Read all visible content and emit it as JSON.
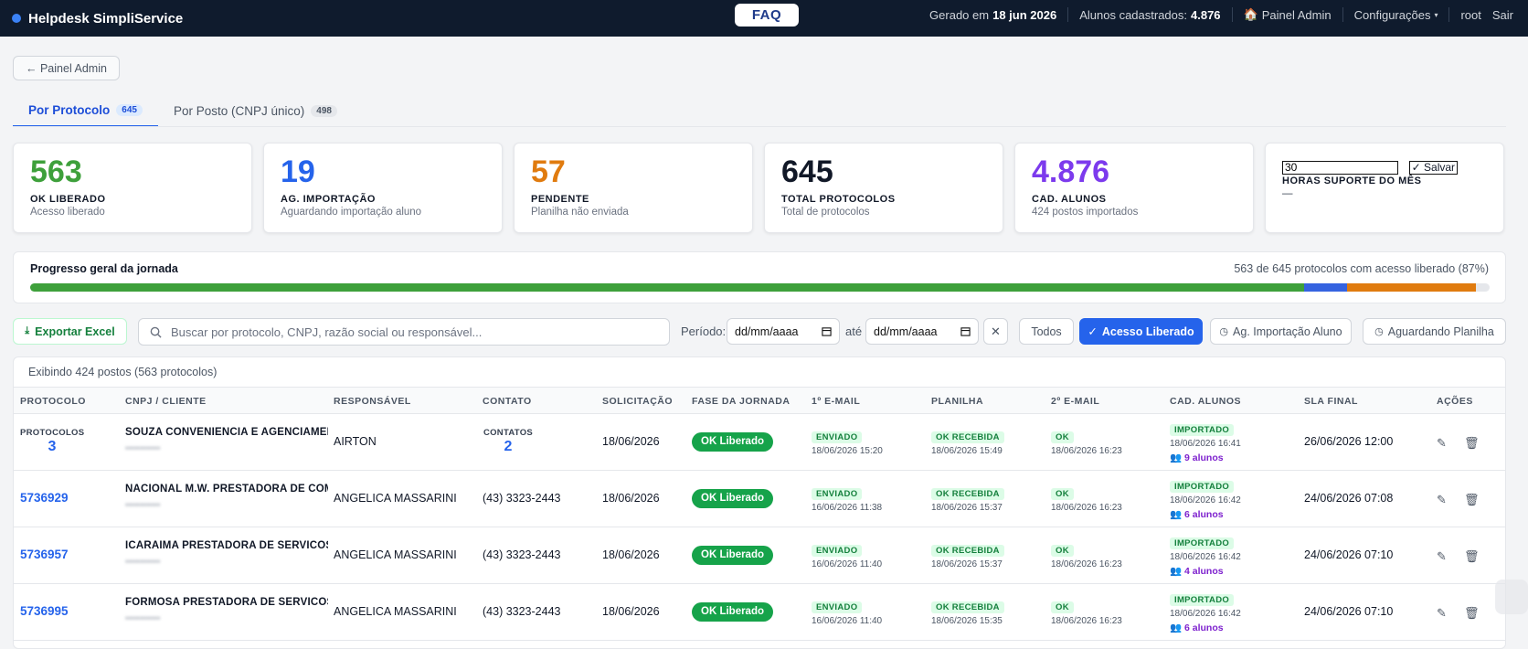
{
  "topbar": {
    "brand": "Helpdesk SimpliService",
    "faq": "FAQ",
    "generated_label": "Gerado em",
    "generated_date": "18 jun 2026",
    "students_label": "Alunos cadastrados:",
    "students_count": "4.876",
    "admin_link": "Painel Admin",
    "settings": "Configurações",
    "user": "root",
    "logout": "Sair"
  },
  "back_button": "← Painel Admin",
  "tabs": [
    {
      "label": "Por Protocolo",
      "count": "645"
    },
    {
      "label": "Por Posto (CNPJ único)",
      "count": "498"
    }
  ],
  "kpis": [
    {
      "value": "563",
      "title": "OK LIBERADO",
      "subtitle": "Acesso liberado",
      "color": "#3ea03b"
    },
    {
      "value": "19",
      "title": "AG. IMPORTAÇÃO",
      "subtitle": "Aguardando importação aluno",
      "color": "#2563eb"
    },
    {
      "value": "57",
      "title": "PENDENTE",
      "subtitle": "Planilha não enviada",
      "color": "#e07b0f"
    },
    {
      "value": "645",
      "title": "TOTAL PROTOCOLOS",
      "subtitle": "Total de protocolos",
      "color": "#111827"
    },
    {
      "value": "4.876",
      "title": "CAD. ALUNOS",
      "subtitle": "424 postos importados",
      "color": "#7c3aed"
    }
  ],
  "hours_card": {
    "input_value": "30",
    "save_label": "✓ Salvar",
    "title": "HORAS SUPORTE DO MÊS",
    "value": "—"
  },
  "progress": {
    "title": "Progresso geral da jornada",
    "summary": "563 de 645 protocolos com acesso liberado (87%)",
    "liberado": 563,
    "ag_importacao": 19,
    "pendente": 57,
    "total": 645
  },
  "filters": {
    "export_label": "Exportar Excel",
    "search_placeholder": "Buscar por protocolo, CNPJ, razão social ou responsável...",
    "period_label": "Período:",
    "date_from": "dd/mm/aaaa",
    "until_label": "até",
    "date_to": "dd/mm/aaaa",
    "status_filters": [
      "Todos",
      "Acesso Liberado",
      "Ag. Importação Aluno",
      "Aguardando Planilha"
    ],
    "active_filter": "Acesso Liberado"
  },
  "table": {
    "showing": "Exibindo 424 postos (563 protocolos)",
    "columns": [
      "PROTOCOLO",
      "CNPJ / CLIENTE",
      "RESPONSÁVEL",
      "CONTATO",
      "SOLICITAÇÃO",
      "FASE DA JORNADA",
      "1º E-MAIL",
      "PLANILHA",
      "2º E-MAIL",
      "CAD. ALUNOS",
      "SLA FINAL",
      "AÇÕES"
    ],
    "rows": [
      {
        "protocol_label": "PROTOCOLOS",
        "protocol": "3",
        "client": "SOUZA CONVENIENCIA E AGENCIAMEN",
        "responsavel": "AIRTON",
        "contact_label": "CONTATOS",
        "contact": "2",
        "solicitacao": "18/06/2026",
        "fase": "OK Liberado",
        "email1_status": "ENVIADO",
        "email1_date": "18/06/2026 15:20",
        "planilha_status": "OK RECEBIDA",
        "planilha_date": "18/06/2026 15:49",
        "email2_status": "OK",
        "email2_date": "18/06/2026 16:23",
        "cad_status": "IMPORTADO",
        "cad_date": "18/06/2026 16:41",
        "alunos": "9 alunos",
        "sla": "26/06/2026 12:00"
      },
      {
        "protocol": "5736929",
        "client": "NACIONAL M.W. PRESTADORA DE COMI",
        "responsavel": "ANGELICA MASSARINI",
        "contact": "(43) 3323-2443",
        "solicitacao": "18/06/2026",
        "fase": "OK Liberado",
        "email1_status": "ENVIADO",
        "email1_date": "16/06/2026 11:38",
        "planilha_status": "OK RECEBIDA",
        "planilha_date": "18/06/2026 15:37",
        "email2_status": "OK",
        "email2_date": "18/06/2026 16:23",
        "cad_status": "IMPORTADO",
        "cad_date": "18/06/2026 16:42",
        "alunos": "6 alunos",
        "sla": "24/06/2026 07:08"
      },
      {
        "protocol": "5736957",
        "client": "ICARAIMA PRESTADORA DE SERVICOS L",
        "responsavel": "ANGELICA MASSARINI",
        "contact": "(43) 3323-2443",
        "solicitacao": "18/06/2026",
        "fase": "OK Liberado",
        "email1_status": "ENVIADO",
        "email1_date": "16/06/2026 11:40",
        "planilha_status": "OK RECEBIDA",
        "planilha_date": "18/06/2026 15:37",
        "email2_status": "OK",
        "email2_date": "18/06/2026 16:23",
        "cad_status": "IMPORTADO",
        "cad_date": "18/06/2026 16:42",
        "alunos": "4 alunos",
        "sla": "24/06/2026 07:10"
      },
      {
        "protocol": "5736995",
        "client": "FORMOSA PRESTADORA DE SERVICOS L",
        "responsavel": "ANGELICA MASSARINI",
        "contact": "(43) 3323-2443",
        "solicitacao": "18/06/2026",
        "fase": "OK Liberado",
        "email1_status": "ENVIADO",
        "email1_date": "16/06/2026 11:40",
        "planilha_status": "OK RECEBIDA",
        "planilha_date": "18/06/2026 15:35",
        "email2_status": "OK",
        "email2_date": "18/06/2026 16:23",
        "cad_status": "IMPORTADO",
        "cad_date": "18/06/2026 16:42",
        "alunos": "6 alunos",
        "sla": "24/06/2026 07:10"
      }
    ]
  },
  "icons": {
    "back": "arrow-left-icon",
    "home": "home-icon",
    "download": "download-icon",
    "search": "search-icon",
    "calendar": "calendar-icon",
    "close": "close-icon",
    "check": "check-icon",
    "clock": "clock-icon",
    "users": "users-icon",
    "edit": "pencil-icon",
    "delete": "trash-icon"
  }
}
